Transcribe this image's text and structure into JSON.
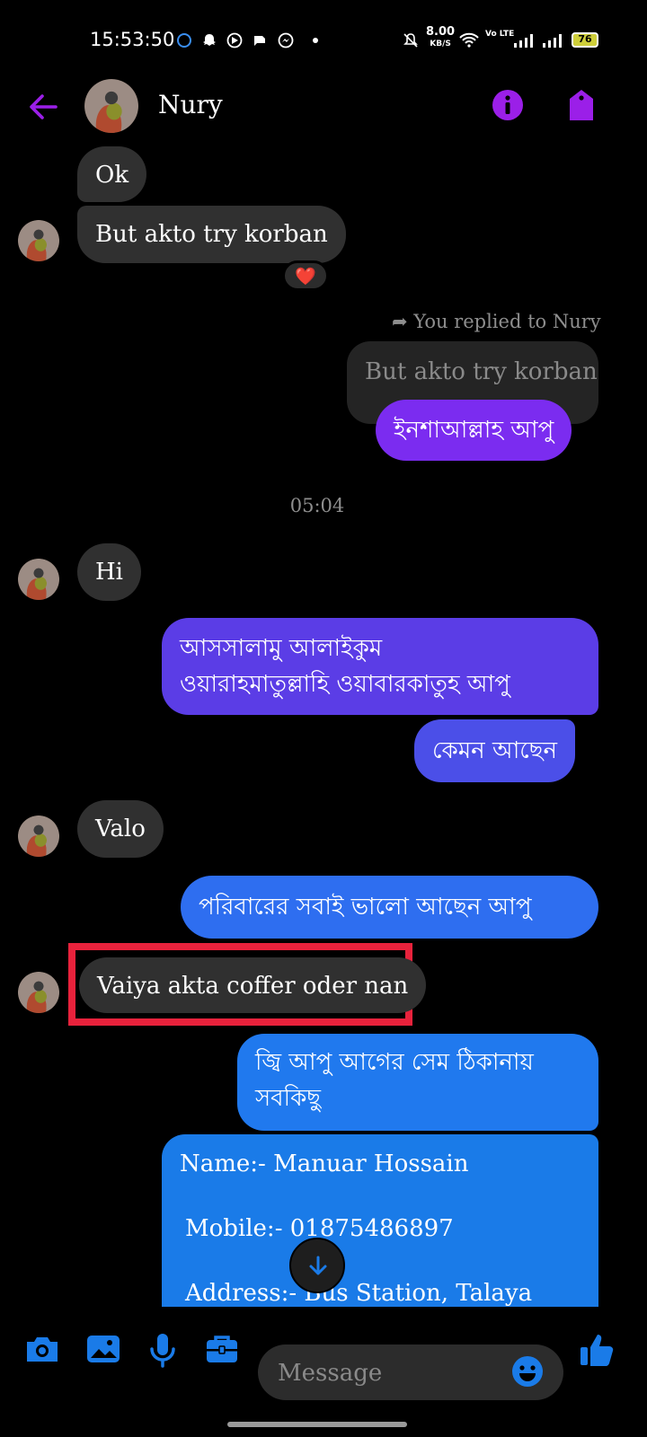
{
  "status_bar": {
    "time": "15:53:50",
    "speed_value": "8.00",
    "speed_unit": "KB/S",
    "network": "Vo LTE",
    "battery": "76"
  },
  "header": {
    "contact_name": "Nury"
  },
  "messages": {
    "m1": "Ok",
    "m2": "But akto try korban",
    "m2_reaction": "❤️",
    "reply_label": "You replied to Nury",
    "quoted": "But akto try korban",
    "m3": "ইনশাআল্লাহ আপু",
    "timestamp": "05:04",
    "m4": "Hi",
    "m5_line1": "আসসালামু আলাইকুম",
    "m5_line2": "ওয়ারাহমাতুল্লাহি ওয়াবারকাতুহ আপু",
    "m6": "কেমন আছেন",
    "m7": "Valo",
    "m8": "পরিবারের সবাই ভালো আছেন আপু",
    "m9": "Vaiya akta coffer oder nan",
    "m10_line1": "জ্বি আপু আগের সেম ঠিকানায়",
    "m10_line2": "সবকিছু",
    "m11_line1": "Name:- Manuar Hossain",
    "m11_line2": "Mobile:- 01875486897",
    "m11_line3": "Address:- Bus Station, Talaya"
  },
  "composer": {
    "placeholder": "Message"
  },
  "colors": {
    "accent": "#9b1fe8",
    "composer_icons": "#1a7be8",
    "highlight": "#e8223c"
  }
}
